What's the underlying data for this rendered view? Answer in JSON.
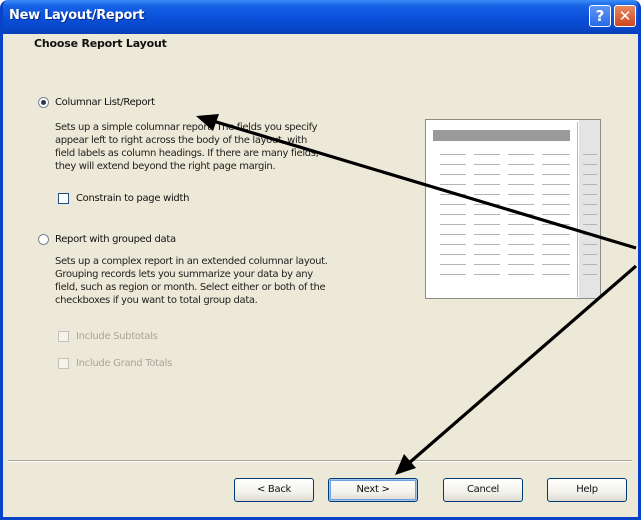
{
  "window": {
    "title": "New Layout/Report"
  },
  "titlebar": {
    "help_label": "?",
    "close_label": "✕"
  },
  "layout": {
    "heading": "Choose Report Layout",
    "columnar": {
      "label": "Columnar List/Report",
      "selected": true,
      "description_lines": [
        "Sets up a simple columnar report. The fields you specify",
        "appear left to right across the body of the layout, with",
        "field labels as column headings. If there are many fields,",
        "they will extend beyond the right page margin."
      ],
      "constrain_label": "Constrain to page width",
      "constrain_checked": false
    },
    "grouped": {
      "label": "Report with grouped data",
      "selected": false,
      "description_lines": [
        "Sets up a complex report in an extended columnar layout.",
        "Grouping records lets you summarize your data by any",
        "field, such as region or month. Select either or both of the",
        "checkboxes if you want to total group data."
      ],
      "subtotals_label": "Include Subtotals",
      "grand_totals_label": "Include Grand Totals"
    }
  },
  "buttons": {
    "back": "< Back",
    "next": "Next >",
    "cancel": "Cancel",
    "help": "Help"
  },
  "colors": {
    "titlebar": "#0a4fd9",
    "dialog_bg": "#ece9d8",
    "annotation_arrow": "#000000"
  }
}
